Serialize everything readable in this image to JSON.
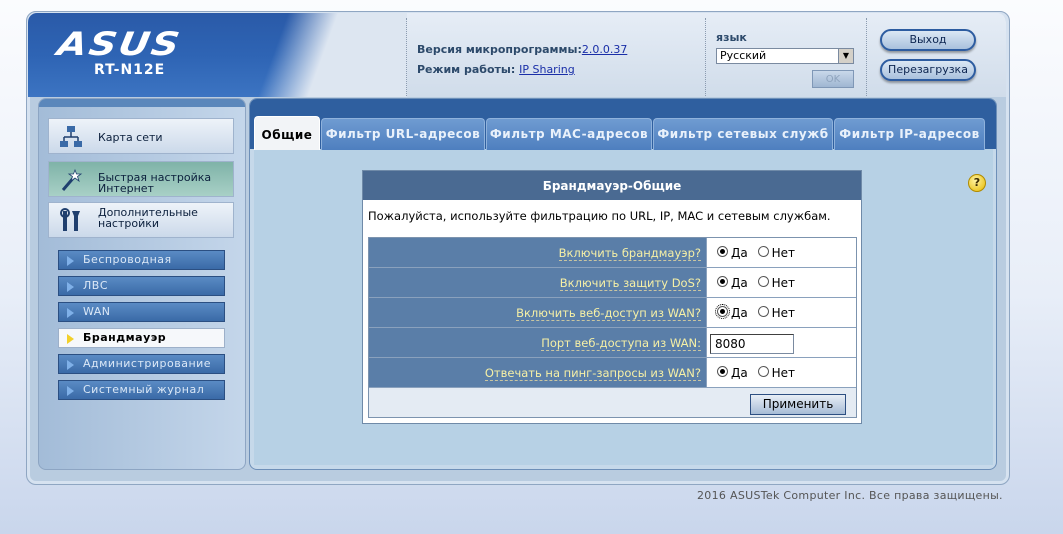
{
  "header": {
    "brand": "ASUS",
    "model": "RT-N12E",
    "firmware_label": "Версия микропрограммы:",
    "firmware_value": "2.0.0.37",
    "mode_label": "Режим работы:",
    "mode_value": "IP Sharing",
    "language_label": "язык",
    "language_value": "Русский",
    "ok_label": "OK",
    "logout_label": "Выход",
    "reboot_label": "Перезагрузка"
  },
  "sidebar": {
    "main_items": [
      {
        "label": "Карта сети",
        "icon": "network-map-icon"
      },
      {
        "label": "Быстрая настройка Интернет",
        "icon": "magic-wand-icon"
      },
      {
        "label": "Дополнительные настройки",
        "icon": "tools-icon"
      }
    ],
    "sub_items": [
      {
        "label": "Беспроводная"
      },
      {
        "label": "ЛВС"
      },
      {
        "label": "WAN"
      },
      {
        "label": "Брандмауэр"
      },
      {
        "label": "Администрирование"
      },
      {
        "label": "Системный журнал"
      }
    ],
    "selected_sub": "Брандмауэр"
  },
  "tabs": [
    {
      "label": "Общие"
    },
    {
      "label": "Фильтр URL-адресов"
    },
    {
      "label": "Фильтр MAC-адресов"
    },
    {
      "label": "Фильтр сетевых служб"
    },
    {
      "label": "Фильтр IP-адресов"
    }
  ],
  "form": {
    "title": "Брандмауэр-Общие",
    "description": "Пожалуйста, используйте фильтрацию по URL, IP, MAC и сетевым службам.",
    "yes_label": "Да",
    "no_label": "Нет",
    "fields": [
      {
        "label": "Включить брандмауэр?",
        "type": "radio",
        "value": "Да"
      },
      {
        "label": "Включить защиту DoS?",
        "type": "radio",
        "value": "Да"
      },
      {
        "label": "Включить веб-доступ из WAN?",
        "type": "radio",
        "value": "Да"
      },
      {
        "label": "Порт веб-доступа из WAN:",
        "type": "text",
        "value": "8080"
      },
      {
        "label": "Отвечать на пинг-запросы из WAN?",
        "type": "radio",
        "value": "Да"
      }
    ],
    "apply_label": "Применить"
  },
  "footer": {
    "copyright": "2016 ASUSTek Computer Inc. Все права защищены."
  },
  "colors": {
    "header_blue": "#2e64b4",
    "panel_blue": "#2f5f9f",
    "label_row_bg": "#5a7ea8",
    "label_text": "#f6f0a6"
  }
}
